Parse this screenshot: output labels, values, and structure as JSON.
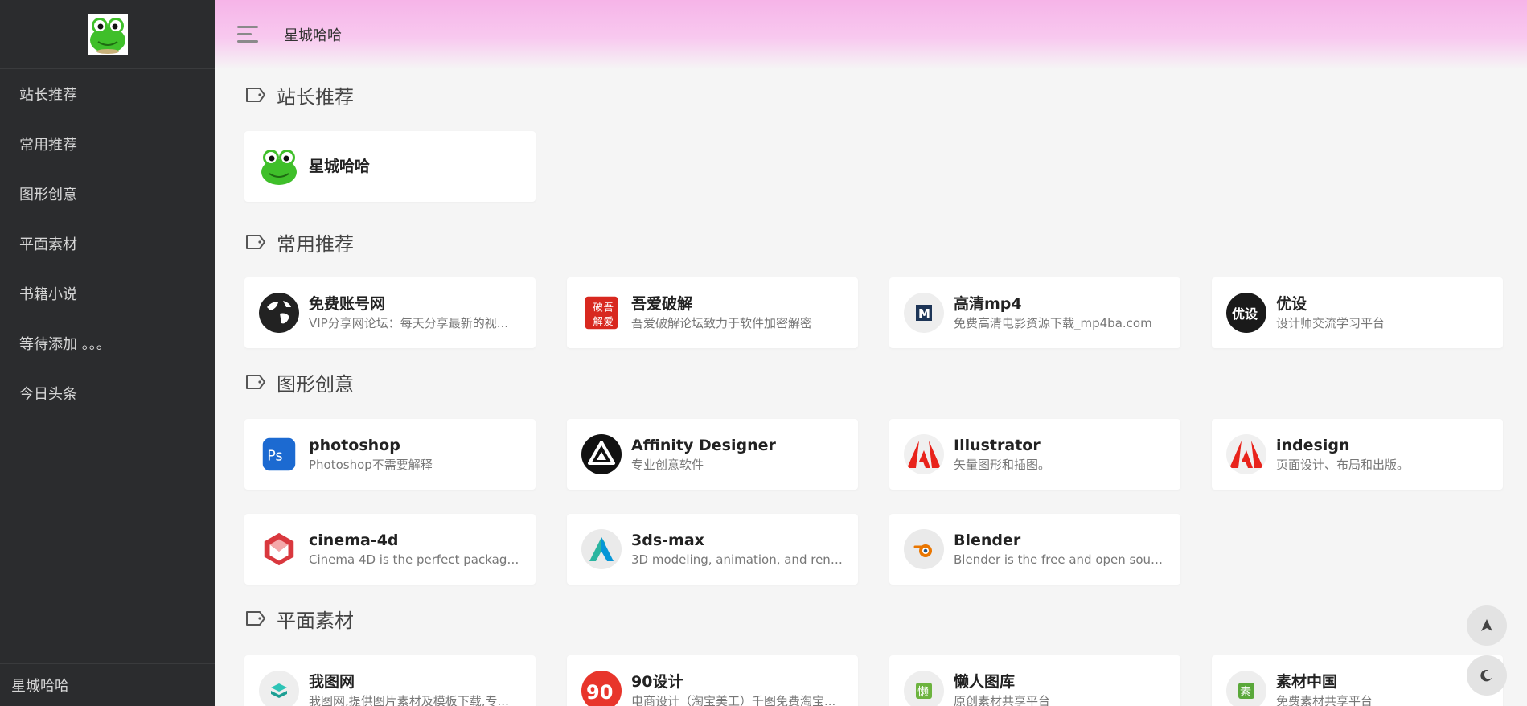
{
  "sidebar": {
    "items": [
      {
        "label": "站长推荐"
      },
      {
        "label": "常用推荐"
      },
      {
        "label": "图形创意"
      },
      {
        "label": "平面素材"
      },
      {
        "label": "书籍小说"
      },
      {
        "label": "等待添加 。。。"
      },
      {
        "label": "今日头条"
      }
    ],
    "footer": "星城哈哈"
  },
  "header": {
    "title": "星城哈哈"
  },
  "sections": [
    {
      "title": "站长推荐",
      "cards": [
        {
          "name": "星城哈哈",
          "desc": "",
          "icon": "frog-icon"
        }
      ]
    },
    {
      "title": "常用推荐",
      "cards": [
        {
          "name": "免费账号网",
          "desc": "VIP分享网论坛：每天分享最新的视...",
          "icon": "globe-icon"
        },
        {
          "name": "吾爱破解",
          "desc": "吾爱破解论坛致力于软件加密解密",
          "icon": "52pojie-icon"
        },
        {
          "name": "高清mp4",
          "desc": "免费高清电影资源下载_mp4ba.com",
          "icon": "mp4ba-icon"
        },
        {
          "name": "优设",
          "desc": "设计师交流学习平台",
          "icon": "uisdc-icon"
        }
      ]
    },
    {
      "title": "图形创意",
      "cards": [
        {
          "name": "photoshop",
          "desc": "Photoshop不需要解释",
          "icon": "photoshop-icon"
        },
        {
          "name": "Affinity Designer",
          "desc": "专业创意软件",
          "icon": "affinity-icon"
        },
        {
          "name": "Illustrator",
          "desc": "矢量图形和插图。",
          "icon": "adobe-icon"
        },
        {
          "name": "indesign",
          "desc": "页面设计、布局和出版。",
          "icon": "adobe-icon"
        },
        {
          "name": "cinema-4d",
          "desc": "Cinema 4D is the perfect package ...",
          "icon": "cinema4d-icon"
        },
        {
          "name": "3ds-max",
          "desc": "3D modeling, animation, and rend...",
          "icon": "autodesk-icon"
        },
        {
          "name": "Blender",
          "desc": "Blender is the free and open sourc...",
          "icon": "blender-icon"
        }
      ]
    },
    {
      "title": "平面素材",
      "cards": [
        {
          "name": "我图网",
          "desc": "我图网,提供图片素材及模板下载,专...",
          "icon": "ooopic-icon"
        },
        {
          "name": "90设计",
          "desc": "电商设计（淘宝美工）千图免费淘宝...",
          "icon": "90sheji-icon"
        },
        {
          "name": "懒人图库",
          "desc": "原创素材共享平台",
          "icon": "lanrentuku-icon"
        },
        {
          "name": "素材中国",
          "desc": "免费素材共享平台",
          "icon": "sccnn-icon"
        }
      ]
    }
  ],
  "colors": {
    "sidebar_bg": "#2b2c2e",
    "header_gradient_top": "#f6b4e8",
    "content_bg": "#f5f5f5"
  }
}
